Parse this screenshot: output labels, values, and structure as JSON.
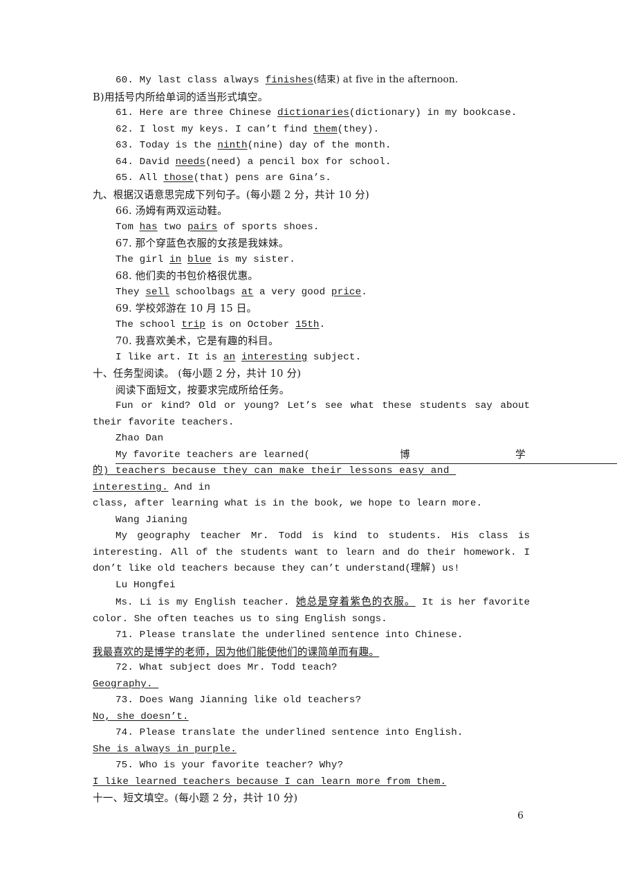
{
  "document": {
    "page_number": "6",
    "section_b_heading": "B)用括号内所给单词的适当形式填空。",
    "items_a": [
      {
        "num": "60.",
        "pre": "My last class always ",
        "blank": "finishes",
        "post": "(结束) at five in the afternoon."
      },
      {
        "num": "61.",
        "pre": "Here are three Chinese ",
        "blank": "dictionaries",
        "post": "(dictionary) in my bookcase."
      },
      {
        "num": "62.",
        "pre": "I lost my keys. I can’t find ",
        "blank": "them",
        "post": "(they)."
      },
      {
        "num": "63.",
        "pre": "Today is the ",
        "blank": "ninth",
        "post": "(nine) day of the month."
      },
      {
        "num": "64.",
        "pre": "David ",
        "blank": "needs",
        "post": "(need) a pencil box for school."
      },
      {
        "num": "65.",
        "pre": "All ",
        "blank": "those",
        "post": "(that) pens are Gina’s."
      }
    ],
    "section_nine": {
      "heading": "九、根据汉语意思完成下列句子。(每小题 2 分，共计 10 分)",
      "items": [
        {
          "num": "66.",
          "chinese": "汤姆有两双运动鞋。",
          "answer_parts": [
            {
              "t": "Tom ",
              "u": false
            },
            {
              "t": "has",
              "u": true
            },
            {
              "t": " two ",
              "u": false
            },
            {
              "t": "pairs",
              "u": true
            },
            {
              "t": " of sports shoes.",
              "u": false
            }
          ]
        },
        {
          "num": "67.",
          "chinese": "那个穿蓝色衣服的女孩是我妹妹。",
          "answer_parts": [
            {
              "t": "The girl ",
              "u": false
            },
            {
              "t": "in",
              "u": true
            },
            {
              "t": " ",
              "u": false
            },
            {
              "t": "blue",
              "u": true
            },
            {
              "t": " is my sister.",
              "u": false
            }
          ]
        },
        {
          "num": "68.",
          "chinese": "他们卖的书包价格很优惠。",
          "answer_parts": [
            {
              "t": "They ",
              "u": false
            },
            {
              "t": "sell",
              "u": true
            },
            {
              "t": " schoolbags ",
              "u": false
            },
            {
              "t": "at",
              "u": true
            },
            {
              "t": " a very good ",
              "u": false
            },
            {
              "t": "price",
              "u": true
            },
            {
              "t": ".",
              "u": false
            }
          ]
        },
        {
          "num": "69.",
          "chinese": "学校郊游在 10 月 15 日。",
          "answer_parts": [
            {
              "t": "The school ",
              "u": false
            },
            {
              "t": "trip",
              "u": true
            },
            {
              "t": " is on October ",
              "u": false
            },
            {
              "t": "15th",
              "u": true
            },
            {
              "t": ".",
              "u": false
            }
          ]
        },
        {
          "num": "70.",
          "chinese": "我喜欢美术，它是有趣的科目。",
          "answer_parts": [
            {
              "t": "I like art. It is ",
              "u": false
            },
            {
              "t": "an",
              "u": true
            },
            {
              "t": " ",
              "u": false
            },
            {
              "t": "interesting",
              "u": true
            },
            {
              "t": " subject.",
              "u": false
            }
          ]
        }
      ]
    },
    "section_ten": {
      "heading": "十、任务型阅读。 (每小题 2 分，共计 10 分)",
      "instruction": "阅读下面短文，按要求完成所给任务。",
      "intro": "Fun or kind? Old or young? Let’s see what these students say about their favorite teachers.",
      "speaker1": "Zhao Dan",
      "gloss_line": {
        "text_before": "My favorite teachers are learned(",
        "cjk_1": "博",
        "cjk_2": "学",
        "line2_underlined": "的) teachers because they can make their lessons easy and interesting.",
        "line2_tail": " And in"
      },
      "p1_rest": "class, after learning what is in the book, we hope to learn more.",
      "speaker2": "Wang Jianing",
      "p2": "My geography teacher Mr. Todd is kind to students. His class is interesting. All of the students want to learn and do their homework. I don’t like old teachers because they can’t understand(理解) us!",
      "speaker3": "Lu Hongfei",
      "p3_a": "Ms. Li is my English teacher. ",
      "p3_underlined": "她总是穿着紫色的衣服。",
      "p3_b": " It is her favorite color. She often teaches us to sing English songs.",
      "questions": [
        {
          "num": "71.",
          "q": "Please translate the underlined sentence into Chinese.",
          "answer": "我最喜欢的是博学的老师，因为他们能使他们的课简单而有趣。",
          "answer_cjk": true
        },
        {
          "num": "72.",
          "q": "What subject does Mr. Todd teach?",
          "answer": "Geography. ",
          "answer_cjk": false
        },
        {
          "num": "73.",
          "q": "Does Wang Jianning like old teachers?",
          "answer": "No, she doesn’t.",
          "answer_cjk": false
        },
        {
          "num": "74.",
          "q": "Please translate the underlined sentence into English.",
          "answer": "She is always in purple.",
          "answer_cjk": false
        },
        {
          "num": "75.",
          "q": "Who is your favorite teacher? Why?",
          "answer": "I like learned teachers because I can learn more from them.",
          "answer_cjk": false
        }
      ]
    },
    "section_eleven": {
      "heading": "十一、短文填空。(每小题 2 分，共计 10 分)"
    }
  }
}
